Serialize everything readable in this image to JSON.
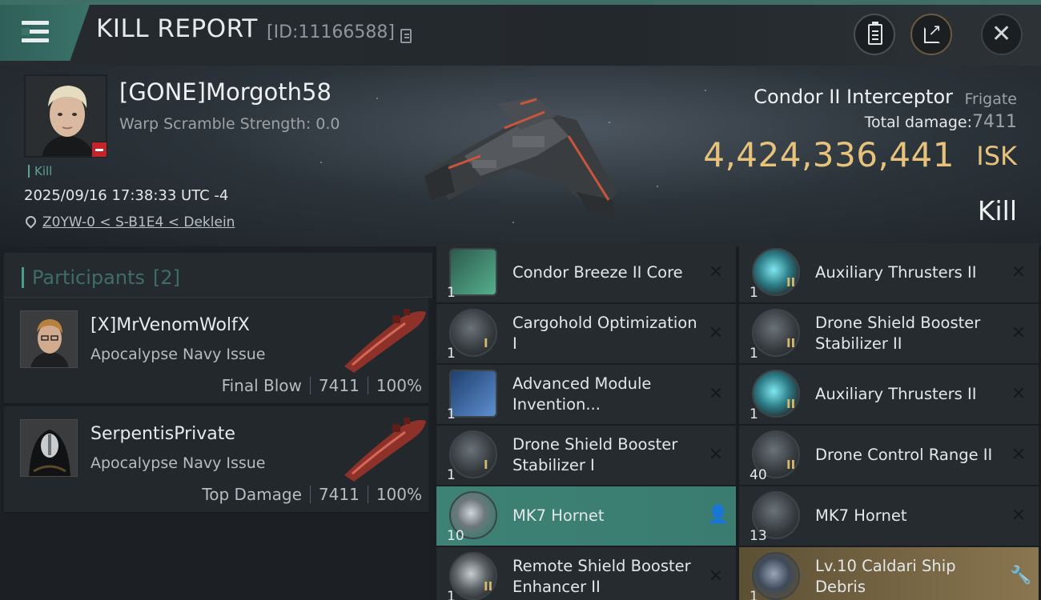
{
  "header": {
    "title": "KILL REPORT",
    "report_id": "[ID:11166588]",
    "icons": {
      "menu": "menu-icon",
      "copy": "copy-icon",
      "report": "clipboard-icon",
      "share": "share-icon",
      "close": "close-icon"
    }
  },
  "victim": {
    "name": "[GONE]Morgoth58",
    "warp_scramble": "Warp Scramble Strength: 0.0",
    "kill_tag": "Kill",
    "datetime": "2025/09/16 17:38:33 UTC -4",
    "location": "Z0YW-0 < S-B1E4 < Deklein",
    "ship_name": "Condor II Interceptor",
    "ship_class": "Frigate",
    "total_damage_label": "Total damage:",
    "total_damage": "7411",
    "isk_value": "4,424,336,441",
    "isk_unit": "ISK",
    "result": "Kill"
  },
  "participants": {
    "label": "Participants",
    "count": "[2]",
    "list": [
      {
        "name": "[X]MrVenomWolfX",
        "ship": "Apocalypse Navy Issue",
        "role": "Final Blow",
        "damage": "7411",
        "percent": "100%"
      },
      {
        "name": "SerpentisPrivate",
        "ship": "Apocalypse Navy Issue",
        "role": "Top Damage",
        "damage": "7411",
        "percent": "100%"
      }
    ]
  },
  "items": [
    {
      "name": "Condor Breeze II Core",
      "qty": "1",
      "meta": "",
      "action": "×",
      "state": "dropped-destroyed"
    },
    {
      "name": "Auxiliary Thrusters II",
      "qty": "1",
      "meta": "II",
      "action": "×",
      "state": "destroyed"
    },
    {
      "name": "Cargohold Optimization I",
      "qty": "1",
      "meta": "I",
      "action": "×",
      "state": "destroyed"
    },
    {
      "name": "Drone Shield Booster Stabilizer II",
      "qty": "1",
      "meta": "II",
      "action": "×",
      "state": "destroyed"
    },
    {
      "name": "Advanced Module Invention...",
      "qty": "1",
      "meta": "",
      "action": "×",
      "state": "destroyed"
    },
    {
      "name": "Auxiliary Thrusters II",
      "qty": "1",
      "meta": "II",
      "action": "×",
      "state": "destroyed"
    },
    {
      "name": "Drone Shield Booster Stabilizer I",
      "qty": "1",
      "meta": "I",
      "action": "×",
      "state": "destroyed"
    },
    {
      "name": "Drone Control Range II",
      "qty": "40",
      "meta": "II",
      "action": "×",
      "state": "destroyed"
    },
    {
      "name": "MK7 Hornet",
      "qty": "10",
      "meta": "",
      "action": "👤",
      "state": "dropped"
    },
    {
      "name": "MK7 Hornet",
      "qty": "13",
      "meta": "",
      "action": "×",
      "state": "destroyed"
    },
    {
      "name": "Remote Shield Booster Enhancer II",
      "qty": "1",
      "meta": "II",
      "action": "×",
      "state": "destroyed"
    },
    {
      "name": "Lv.10 Caldari Ship Debris",
      "qty": "1",
      "meta": "",
      "action": "🔧",
      "state": "salvage"
    }
  ],
  "colors": {
    "accent_teal": "#3d8275",
    "isk_gold": "#e7c27a",
    "salvage_gold": "#8a7650",
    "danger_red": "#c3242a"
  }
}
